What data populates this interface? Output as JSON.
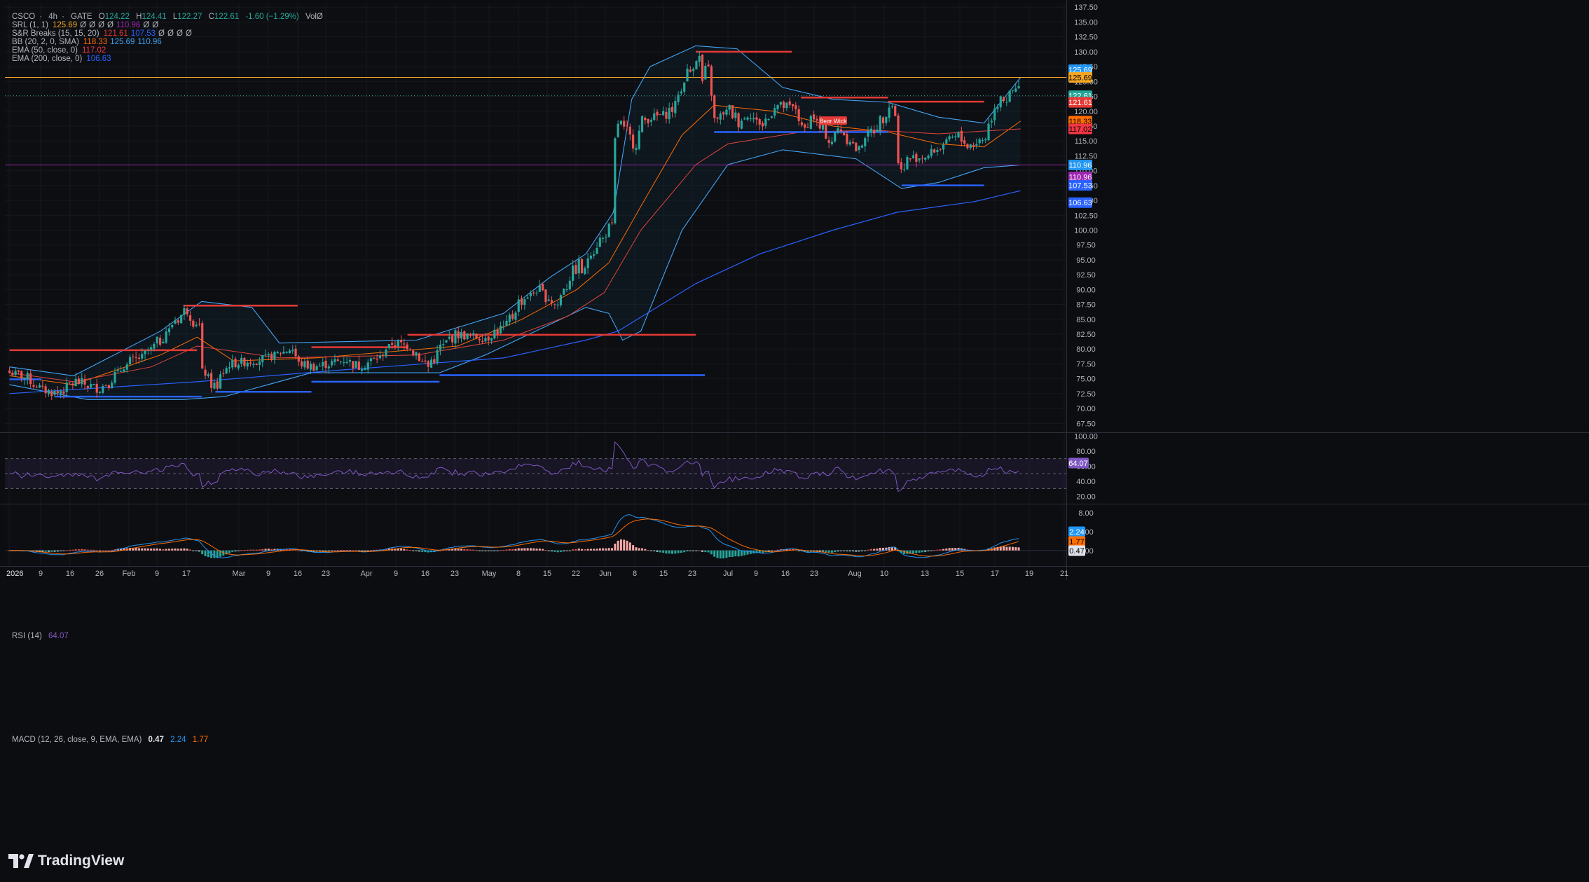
{
  "header": {
    "symbol": "CSCO",
    "timeframe": "4h",
    "exchange": "GATE",
    "open_label": "O",
    "open": "124.22",
    "high_label": "H",
    "high": "124.41",
    "low_label": "L",
    "low": "122.27",
    "close_label": "C",
    "close": "122.61",
    "change": "-1.60 (−1.29%)",
    "vol": "VolØ"
  },
  "indicators": [
    {
      "name": "SRL (1, 1)",
      "values": [
        {
          "text": "125.69",
          "color": "#f5a623"
        },
        {
          "text": "Ø",
          "color": "#b2b5be"
        },
        {
          "text": "Ø",
          "color": "#b2b5be"
        },
        {
          "text": "Ø",
          "color": "#b2b5be"
        },
        {
          "text": "Ø",
          "color": "#b2b5be"
        },
        {
          "text": "110.96",
          "color": "#9c27b0"
        },
        {
          "text": "Ø",
          "color": "#b2b5be"
        },
        {
          "text": "Ø",
          "color": "#b2b5be"
        }
      ]
    },
    {
      "name": "S&R Breaks (15, 15, 20)",
      "values": [
        {
          "text": "121.61",
          "color": "#e53935"
        },
        {
          "text": "107.53",
          "color": "#2962ff"
        },
        {
          "text": "Ø",
          "color": "#b2b5be"
        },
        {
          "text": "Ø",
          "color": "#b2b5be"
        },
        {
          "text": "Ø",
          "color": "#b2b5be"
        },
        {
          "text": "Ø",
          "color": "#b2b5be"
        }
      ]
    },
    {
      "name": "BB (20, 2, 0, SMA)",
      "values": [
        {
          "text": "118.33",
          "color": "#ff6d00"
        },
        {
          "text": "125.69",
          "color": "#42a5f5"
        },
        {
          "text": "110.96",
          "color": "#42a5f5"
        }
      ]
    },
    {
      "name": "EMA (50, close, 0)",
      "values": [
        {
          "text": "117.02",
          "color": "#f23645"
        }
      ]
    },
    {
      "name": "EMA (200, close, 0)",
      "values": [
        {
          "text": "106.63",
          "color": "#2962ff"
        }
      ]
    }
  ],
  "rsi_legend": {
    "name": "RSI (14)",
    "value": "64.07",
    "color": "#7e57c2"
  },
  "macd_legend": {
    "name": "MACD (12, 26, close, 9, EMA, EMA)",
    "macd": "0.47",
    "signal": "2.24",
    "hist": "1.77"
  },
  "price_axis_ticks": [
    "137.50",
    "135.00",
    "132.50",
    "130.00",
    "127.50",
    "125.00",
    "122.50",
    "120.00",
    "117.50",
    "115.00",
    "112.50",
    "110.00",
    "107.50",
    "105.00",
    "102.50",
    "100.00",
    "97.50",
    "95.00",
    "92.50",
    "90.00",
    "87.50",
    "85.00",
    "82.50",
    "80.00",
    "77.50",
    "75.00",
    "72.50",
    "70.00",
    "67.50"
  ],
  "price_tags": [
    {
      "text": "125.69",
      "bg": "#2196f3",
      "fg": "#ffffff",
      "price": 125.69,
      "offset": -11
    },
    {
      "text": "125.69",
      "bg": "#f5a623",
      "fg": "#000000",
      "price": 125.69,
      "offset": 0
    },
    {
      "text": "122.61",
      "bg": "#26a69a",
      "fg": "#ffffff",
      "price": 122.61,
      "offset": 0
    },
    {
      "text": "121.61",
      "bg": "#e53935",
      "fg": "#ffffff",
      "price": 121.61,
      "offset": 1
    },
    {
      "text": "118.33",
      "bg": "#ff6d00",
      "fg": "#000000",
      "price": 118.33,
      "offset": 0
    },
    {
      "text": "117.02",
      "bg": "#f23645",
      "fg": "#000000",
      "price": 117.02,
      "offset": 0
    },
    {
      "text": "110.96",
      "bg": "#2196f3",
      "fg": "#ffffff",
      "price": 110.96,
      "offset": 0
    },
    {
      "text": "110.96",
      "bg": "#9c27b0",
      "fg": "#ffffff",
      "price": 110.96,
      "offset": 17
    },
    {
      "text": "107.53",
      "bg": "#2962ff",
      "fg": "#ffffff",
      "price": 107.53,
      "offset": 0
    },
    {
      "text": "106.63",
      "bg": "#2962ff",
      "fg": "#ffffff",
      "price": 106.63,
      "offset": 17
    }
  ],
  "rsi_axis_ticks": [
    "100.00",
    "80.00",
    "60.00",
    "40.00",
    "20.00"
  ],
  "rsi_tag": {
    "text": "64.07",
    "bg": "#7e57c2"
  },
  "macd_axis_ticks": [
    "8.00",
    "4.00",
    "0.00"
  ],
  "macd_tags": [
    {
      "text": "2.24",
      "bg": "#2196f3",
      "fg": "#ffffff"
    },
    {
      "text": "1.77",
      "bg": "#ff6d00",
      "fg": "#000000"
    },
    {
      "text": "0.47",
      "bg": "#e0e3eb",
      "fg": "#000000"
    }
  ],
  "time_axis": [
    "2026",
    "9",
    "16",
    "26",
    "Feb",
    "9",
    "17",
    "Mar",
    "9",
    "16",
    "23",
    "Apr",
    "9",
    "16",
    "23",
    "May",
    "8",
    "15",
    "22",
    "Jun",
    "8",
    "15",
    "23",
    "Jul",
    "9",
    "16",
    "23",
    "Aug",
    "10",
    "13",
    "15",
    "17",
    "19",
    "21"
  ],
  "annotation": {
    "text": "Bear Wick"
  },
  "brand": {
    "name": "TradingView"
  },
  "colors": {
    "up": "#26a69a",
    "down": "#ef5350",
    "bb": "#42a5f5",
    "ema50": "#f57c00",
    "ema200": "#2962ff",
    "resistance": "#e53935",
    "support": "#2962ff",
    "srl_high": "#f5a623",
    "srl_low": "#9c27b0",
    "rsi": "#7e57c2"
  },
  "chart_data": {
    "type": "candlestick",
    "title": "CSCO · 4h · GATE",
    "ylim": [
      66,
      138
    ],
    "close_path": [
      [
        "2026-01-02",
        76.0
      ],
      [
        "2026-01-05",
        75.2
      ],
      [
        "2026-01-07",
        74.0
      ],
      [
        "2026-01-09",
        73.0
      ],
      [
        "2026-01-12",
        72.6
      ],
      [
        "2026-01-14",
        73.6
      ],
      [
        "2026-01-16",
        74.6
      ],
      [
        "2026-01-19",
        73.8
      ],
      [
        "2026-01-21",
        73.4
      ],
      [
        "2026-01-23",
        74.2
      ],
      [
        "2026-01-26",
        76.5
      ],
      [
        "2026-01-28",
        78.0
      ],
      [
        "2026-01-30",
        78.5
      ],
      [
        "2026-02-02",
        80.5
      ],
      [
        "2026-02-04",
        82.0
      ],
      [
        "2026-02-06",
        84.2
      ],
      [
        "2026-02-09",
        86.5
      ],
      [
        "2026-02-10",
        85.5
      ],
      [
        "2026-02-11",
        84.5
      ],
      [
        "2026-02-12",
        84.0
      ],
      [
        "2026-02-13",
        76.0
      ],
      [
        "2026-02-16",
        73.0
      ],
      [
        "2026-02-17",
        76.0
      ],
      [
        "2026-02-19",
        77.5
      ],
      [
        "2026-02-23",
        78.0
      ],
      [
        "2026-02-27",
        78.5
      ],
      [
        "2026-03-02",
        79.5
      ],
      [
        "2026-03-04",
        80.0
      ],
      [
        "2026-03-06",
        77.5
      ],
      [
        "2026-03-09",
        77.0
      ],
      [
        "2026-03-12",
        77.5
      ],
      [
        "2026-03-16",
        78.2
      ],
      [
        "2026-03-19",
        77.0
      ],
      [
        "2026-03-23",
        78.5
      ],
      [
        "2026-03-26",
        81.0
      ],
      [
        "2026-03-30",
        80.5
      ],
      [
        "2026-04-01",
        78.5
      ],
      [
        "2026-04-03",
        77.0
      ],
      [
        "2026-04-06",
        80.5
      ],
      [
        "2026-04-09",
        82.5
      ],
      [
        "2026-04-13",
        82.0
      ],
      [
        "2026-04-16",
        82.0
      ],
      [
        "2026-04-20",
        84.0
      ],
      [
        "2026-04-23",
        88.0
      ],
      [
        "2026-04-27",
        90.0
      ],
      [
        "2026-04-30",
        88.0
      ],
      [
        "2026-05-01",
        87.5
      ],
      [
        "2026-05-04",
        92.0
      ],
      [
        "2026-05-06",
        94.5
      ],
      [
        "2026-05-07",
        93.0
      ],
      [
        "2026-05-08",
        95.5
      ],
      [
        "2026-05-11",
        98.5
      ],
      [
        "2026-05-13",
        100.5
      ],
      [
        "2026-05-14",
        115.0
      ],
      [
        "2026-05-15",
        118.0
      ],
      [
        "2026-05-18",
        114.5
      ],
      [
        "2026-05-20",
        118.5
      ],
      [
        "2026-05-22",
        119.0
      ],
      [
        "2026-05-25",
        119.5
      ],
      [
        "2026-05-27",
        121.0
      ],
      [
        "2026-05-29",
        125.5
      ],
      [
        "2026-06-01",
        129.0
      ],
      [
        "2026-06-02",
        125.0
      ],
      [
        "2026-06-03",
        127.0
      ],
      [
        "2026-06-04",
        123.0
      ],
      [
        "2026-06-05",
        118.5
      ],
      [
        "2026-06-08",
        120.5
      ],
      [
        "2026-06-10",
        118.0
      ],
      [
        "2026-06-12",
        119.5
      ],
      [
        "2026-06-15",
        117.5
      ],
      [
        "2026-06-18",
        121.0
      ],
      [
        "2026-06-22",
        120.5
      ],
      [
        "2026-06-24",
        117.0
      ],
      [
        "2026-06-26",
        119.0
      ],
      [
        "2026-06-30",
        115.0
      ],
      [
        "2026-07-02",
        117.0
      ],
      [
        "2026-07-06",
        113.5
      ],
      [
        "2026-07-08",
        116.0
      ],
      [
        "2026-07-10",
        117.5
      ],
      [
        "2026-07-13",
        121.0
      ],
      [
        "2026-07-14",
        119.5
      ],
      [
        "2026-07-15",
        111.0
      ],
      [
        "2026-07-16",
        110.0
      ],
      [
        "2026-07-17",
        112.0
      ],
      [
        "2026-07-21",
        112.5
      ],
      [
        "2026-07-24",
        114.0
      ],
      [
        "2026-07-28",
        116.0
      ],
      [
        "2026-07-30",
        114.0
      ],
      [
        "2026-08-03",
        115.5
      ],
      [
        "2026-08-05",
        121.0
      ],
      [
        "2026-08-06",
        123.0
      ],
      [
        "2026-08-07",
        122.0
      ],
      [
        "2026-08-10",
        124.0
      ],
      [
        "2026-08-11",
        122.61
      ]
    ],
    "ema200_path": [
      [
        "2026-01-02",
        72.5
      ],
      [
        "2026-02-12",
        74.5
      ],
      [
        "2026-03-16",
        76.5
      ],
      [
        "2026-04-20",
        78.5
      ],
      [
        "2026-05-08",
        81.5
      ],
      [
        "2026-05-15",
        83.0
      ],
      [
        "2026-06-01",
        91.0
      ],
      [
        "2026-06-15",
        96.0
      ],
      [
        "2026-07-01",
        100.0
      ],
      [
        "2026-07-15",
        103.0
      ],
      [
        "2026-08-01",
        104.8
      ],
      [
        "2026-08-11",
        106.63
      ]
    ],
    "ema50_path": [
      [
        "2026-01-02",
        76.0
      ],
      [
        "2026-01-16",
        74.5
      ],
      [
        "2026-02-02",
        77.0
      ],
      [
        "2026-02-12",
        80.5
      ],
      [
        "2026-03-02",
        78.5
      ],
      [
        "2026-04-01",
        79.0
      ],
      [
        "2026-04-20",
        81.5
      ],
      [
        "2026-05-04",
        85.5
      ],
      [
        "2026-05-12",
        89.5
      ],
      [
        "2026-05-20",
        100.0
      ],
      [
        "2026-06-01",
        111.0
      ],
      [
        "2026-06-08",
        114.5
      ],
      [
        "2026-06-24",
        116.5
      ],
      [
        "2026-07-10",
        116.8
      ],
      [
        "2026-07-24",
        116.2
      ],
      [
        "2026-08-11",
        117.02
      ]
    ],
    "bb_basis_path": [
      [
        "2026-01-02",
        75.5
      ],
      [
        "2026-01-16",
        74.0
      ],
      [
        "2026-02-04",
        79.0
      ],
      [
        "2026-02-12",
        82.0
      ],
      [
        "2026-02-20",
        78.0
      ],
      [
        "2026-03-10",
        78.5
      ],
      [
        "2026-04-10",
        80.5
      ],
      [
        "2026-04-24",
        85.0
      ],
      [
        "2026-05-06",
        90.0
      ],
      [
        "2026-05-13",
        94.5
      ],
      [
        "2026-05-20",
        104.0
      ],
      [
        "2026-05-29",
        116.0
      ],
      [
        "2026-06-05",
        121.0
      ],
      [
        "2026-06-18",
        120.0
      ],
      [
        "2026-07-01",
        117.5
      ],
      [
        "2026-07-13",
        116.5
      ],
      [
        "2026-07-24",
        114.5
      ],
      [
        "2026-08-03",
        114.0
      ],
      [
        "2026-08-11",
        118.33
      ]
    ],
    "bb_upper_path": [
      [
        "2026-01-02",
        77.0
      ],
      [
        "2026-01-16",
        75.5
      ],
      [
        "2026-02-04",
        83.0
      ],
      [
        "2026-02-13",
        88.0
      ],
      [
        "2026-02-24",
        87.0
      ],
      [
        "2026-03-02",
        81.0
      ],
      [
        "2026-04-01",
        81.5
      ],
      [
        "2026-04-20",
        86.0
      ],
      [
        "2026-04-30",
        92.0
      ],
      [
        "2026-05-08",
        96.0
      ],
      [
        "2026-05-14",
        103.0
      ],
      [
        "2026-05-18",
        122.0
      ],
      [
        "2026-05-22",
        127.5
      ],
      [
        "2026-06-01",
        131.0
      ],
      [
        "2026-06-10",
        130.5
      ],
      [
        "2026-06-20",
        124.0
      ],
      [
        "2026-07-01",
        122.0
      ],
      [
        "2026-07-13",
        121.5
      ],
      [
        "2026-07-24",
        119.0
      ],
      [
        "2026-08-03",
        118.0
      ],
      [
        "2026-08-11",
        125.69
      ]
    ],
    "bb_lower_path": [
      [
        "2026-01-02",
        74.0
      ],
      [
        "2026-01-19",
        71.5
      ],
      [
        "2026-02-09",
        71.5
      ],
      [
        "2026-02-18",
        72.0
      ],
      [
        "2026-03-09",
        76.0
      ],
      [
        "2026-04-06",
        76.0
      ],
      [
        "2026-04-16",
        79.0
      ],
      [
        "2026-04-27",
        83.0
      ],
      [
        "2026-05-08",
        87.0
      ],
      [
        "2026-05-13",
        86.0
      ],
      [
        "2026-05-16",
        81.5
      ],
      [
        "2026-05-20",
        83.0
      ],
      [
        "2026-05-29",
        100.0
      ],
      [
        "2026-06-08",
        111.0
      ],
      [
        "2026-06-20",
        113.5
      ],
      [
        "2026-07-06",
        112.0
      ],
      [
        "2026-07-16",
        107.0
      ],
      [
        "2026-07-24",
        108.0
      ],
      [
        "2026-08-03",
        110.5
      ],
      [
        "2026-08-11",
        110.96
      ]
    ],
    "resistance_lines": [
      {
        "from": "2026-01-02",
        "to": "2026-02-12",
        "price": 79.8
      },
      {
        "from": "2026-02-09",
        "to": "2026-03-06",
        "price": 87.3
      },
      {
        "from": "2026-03-09",
        "to": "2026-03-30",
        "price": 80.3
      },
      {
        "from": "2026-03-30",
        "to": "2026-06-01",
        "price": 82.4
      },
      {
        "from": "2026-06-01",
        "to": "2026-06-22",
        "price": 130.0
      },
      {
        "from": "2026-06-24",
        "to": "2026-07-13",
        "price": 122.3
      },
      {
        "from": "2026-07-13",
        "to": "2026-08-03",
        "price": 121.61
      }
    ],
    "support_lines": [
      {
        "from": "2026-01-02",
        "to": "2026-01-09",
        "price": 74.9
      },
      {
        "from": "2026-01-12",
        "to": "2026-02-13",
        "price": 72.0
      },
      {
        "from": "2026-02-16",
        "to": "2026-03-09",
        "price": 72.8
      },
      {
        "from": "2026-03-09",
        "to": "2026-04-06",
        "price": 74.5
      },
      {
        "from": "2026-04-06",
        "to": "2026-06-03",
        "price": 75.6
      },
      {
        "from": "2026-06-05",
        "to": "2026-07-13",
        "price": 116.5
      },
      {
        "from": "2026-07-16",
        "to": "2026-08-03",
        "price": 107.53
      }
    ],
    "horizontal_levels": [
      {
        "name": "SRL high",
        "price": 125.69
      },
      {
        "name": "SRL low",
        "price": 110.96
      },
      {
        "name": "Last close",
        "price": 122.61
      }
    ],
    "rsi": {
      "ylim": [
        20,
        100
      ],
      "bands": [
        30,
        50,
        70
      ],
      "last": 64.07
    },
    "macd": {
      "ylim": [
        -3,
        9
      ],
      "macd_last": 0.47,
      "signal_last": 2.24,
      "hist_last": 1.77
    }
  }
}
